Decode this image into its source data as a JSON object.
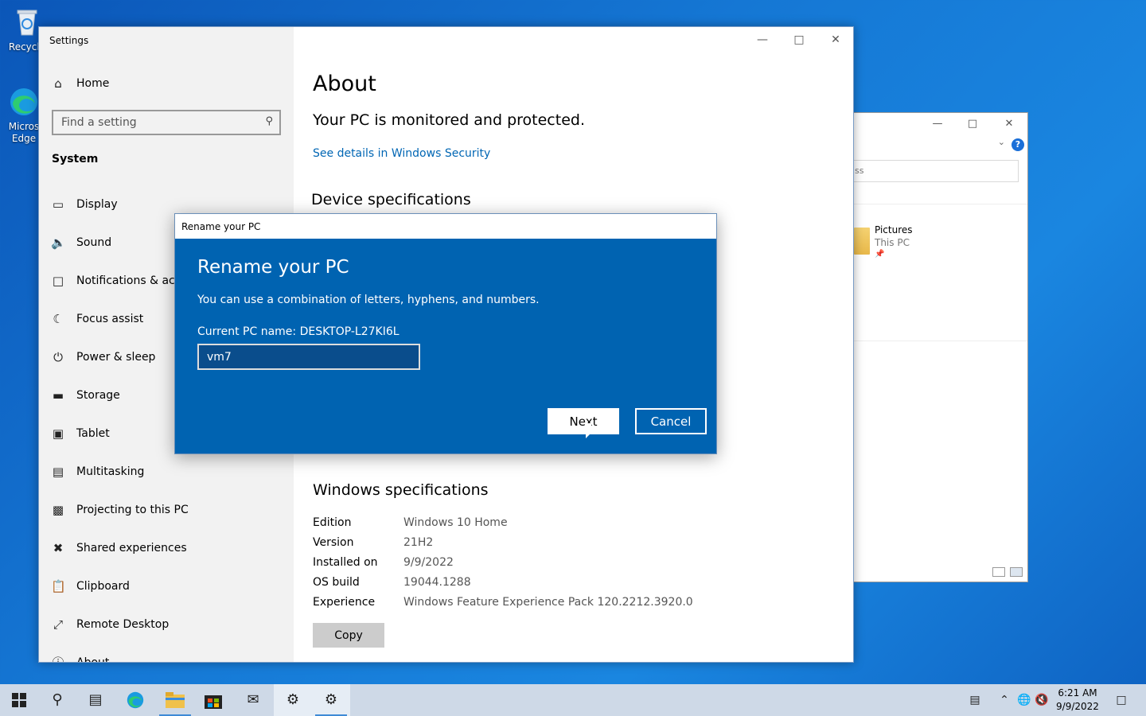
{
  "desktop": {
    "icons": [
      {
        "label": "Recycle"
      },
      {
        "label": "Micros Edge"
      }
    ]
  },
  "explorer": {
    "address_partial": "ss",
    "item_name": "Pictures",
    "item_location": "This PC",
    "help_label": "?"
  },
  "settings": {
    "app_title": "Settings",
    "home_label": "Home",
    "search_placeholder": "Find a setting",
    "section_title": "System",
    "nav": [
      {
        "label": "Display"
      },
      {
        "label": "Sound"
      },
      {
        "label": "Notifications & actio"
      },
      {
        "label": "Focus assist"
      },
      {
        "label": "Power & sleep"
      },
      {
        "label": "Storage"
      },
      {
        "label": "Tablet"
      },
      {
        "label": "Multitasking"
      },
      {
        "label": "Projecting to this PC"
      },
      {
        "label": "Shared experiences"
      },
      {
        "label": "Clipboard"
      },
      {
        "label": "Remote Desktop"
      },
      {
        "label": "About"
      }
    ],
    "page_title": "About",
    "protection_status": "Your PC is monitored and protected.",
    "security_link": "See details in Windows Security",
    "device_specs_heading": "Device specifications",
    "windows_specs_heading": "Windows specifications",
    "windows_specs": [
      {
        "key": "Edition",
        "value": "Windows 10 Home"
      },
      {
        "key": "Version",
        "value": "21H2"
      },
      {
        "key": "Installed on",
        "value": "9/9/2022"
      },
      {
        "key": "OS build",
        "value": "19044.1288"
      },
      {
        "key": "Experience",
        "value": "Windows Feature Experience Pack 120.2212.3920.0"
      }
    ],
    "copy_label": "Copy"
  },
  "dialog": {
    "window_title": "Rename your PC",
    "heading": "Rename your PC",
    "description": "You can use a combination of letters, hyphens, and numbers.",
    "current_name": "Current PC name: DESKTOP-L27KI6L",
    "input_value": "vm7",
    "next_label": "Next",
    "cancel_label": "Cancel"
  },
  "taskbar": {
    "time": "6:21 AM",
    "date": "9/9/2022"
  },
  "colors": {
    "accent": "#0063b1",
    "link": "#0066b4",
    "taskbar": "#ced9e7"
  }
}
